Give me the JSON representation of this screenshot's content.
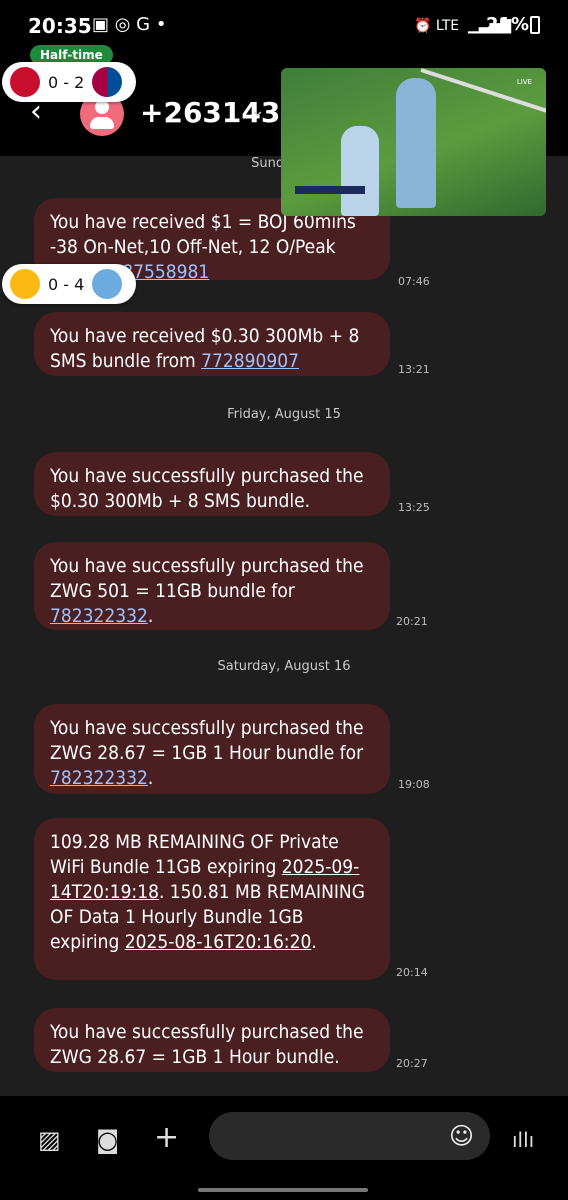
{
  "status": {
    "time": "20:35",
    "notif_icons": "▣ ◎ G •",
    "right_icons": "⏰ LTE",
    "battery": "21%"
  },
  "header": {
    "back_icon": "back-arrow-icon",
    "number": "+263143",
    "chevron": "⌄"
  },
  "live_scores": {
    "match1": {
      "badge": "Half-time",
      "score": "0 - 2"
    },
    "match2": {
      "score": "0 - 4"
    },
    "video_label": "LIVE"
  },
  "messages": [
    {
      "date": "Sunday, A",
      "text_before": "You have received $1 = BOJ 60mins -38 On-Net,10 Off-Net, 12 O/Peak ...from ",
      "link": "787558981",
      "text_after": "",
      "time": "07:46"
    },
    {
      "date": "",
      "text_before": "You have received $0.30 300Mb + 8 SMS bundle from ",
      "link": "772890907",
      "text_after": "",
      "time": "13:21"
    },
    {
      "date": "Friday, August 15",
      "text_before": "You have successfully purchased the $0.30 300Mb + 8 SMS bundle.",
      "link": "",
      "text_after": "",
      "time": "13:25"
    },
    {
      "date": "",
      "text_before": "You have successfully purchased the ZWG 501 = 11GB bundle for ",
      "link": "782322332",
      "text_after": ".",
      "time": "20:21"
    },
    {
      "date": "Saturday, August 16",
      "text_before": "You have successfully purchased the ZWG 28.67 = 1GB 1 Hour bundle for ",
      "link": "782322332",
      "text_after": ".",
      "time": "19:08"
    },
    {
      "date": "",
      "text_before": "109.28 MB REMAINING OF Private WiFi Bundle 11GB expiring ",
      "link": "2025-09-14T20:19:18",
      "text_after": ". 150.81 MB REMAINING OF Data 1 Hourly Bundle 1GB expiring ",
      "link2": "2025-08-16T20:16:20",
      "text_after2": ".",
      "time": "20:14"
    },
    {
      "date": "",
      "text_before": "You have successfully purchased the ZWG 28.67 = 1GB 1 Hour bundle.",
      "link": "",
      "text_after": "",
      "time": "20:27"
    }
  ],
  "composer": {
    "gallery_icon": "image-icon",
    "camera_icon": "camera-icon",
    "add_icon": "plus-icon",
    "emoji_icon": "emoji-icon",
    "voice_icon": "voice-icon",
    "placeholder": ""
  }
}
